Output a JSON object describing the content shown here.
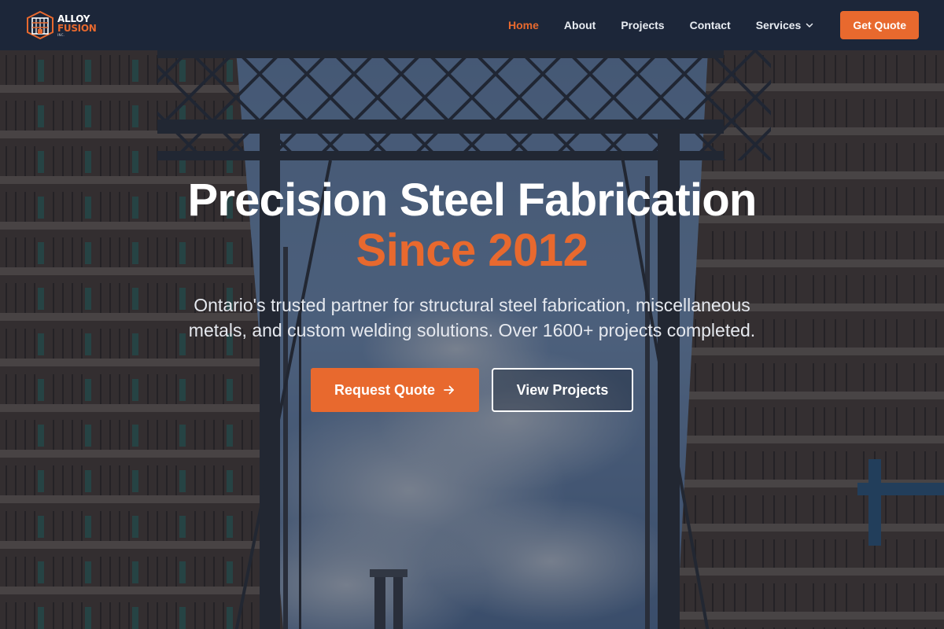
{
  "brand": {
    "line1": "ALLOY",
    "line2": "FUSION",
    "line3": "INC.",
    "accent_color": "#e8692e",
    "nav_bg": "#1c2639"
  },
  "nav": {
    "links": [
      {
        "label": "Home",
        "active": true
      },
      {
        "label": "About",
        "active": false
      },
      {
        "label": "Projects",
        "active": false
      },
      {
        "label": "Contact",
        "active": false
      },
      {
        "label": "Services",
        "active": false,
        "icon": "chevron-down-icon"
      }
    ],
    "cta_label": "Get Quote"
  },
  "hero": {
    "title": "Precision Steel Fabrication",
    "subtitle": "Since 2012",
    "description": "Ontario's trusted partner for structural steel fabrication, miscellaneous metals, and custom welding solutions. Over 1600+ projects completed.",
    "primary_cta": "Request Quote",
    "primary_cta_icon": "arrow-right-icon",
    "secondary_cta": "View Projects"
  }
}
